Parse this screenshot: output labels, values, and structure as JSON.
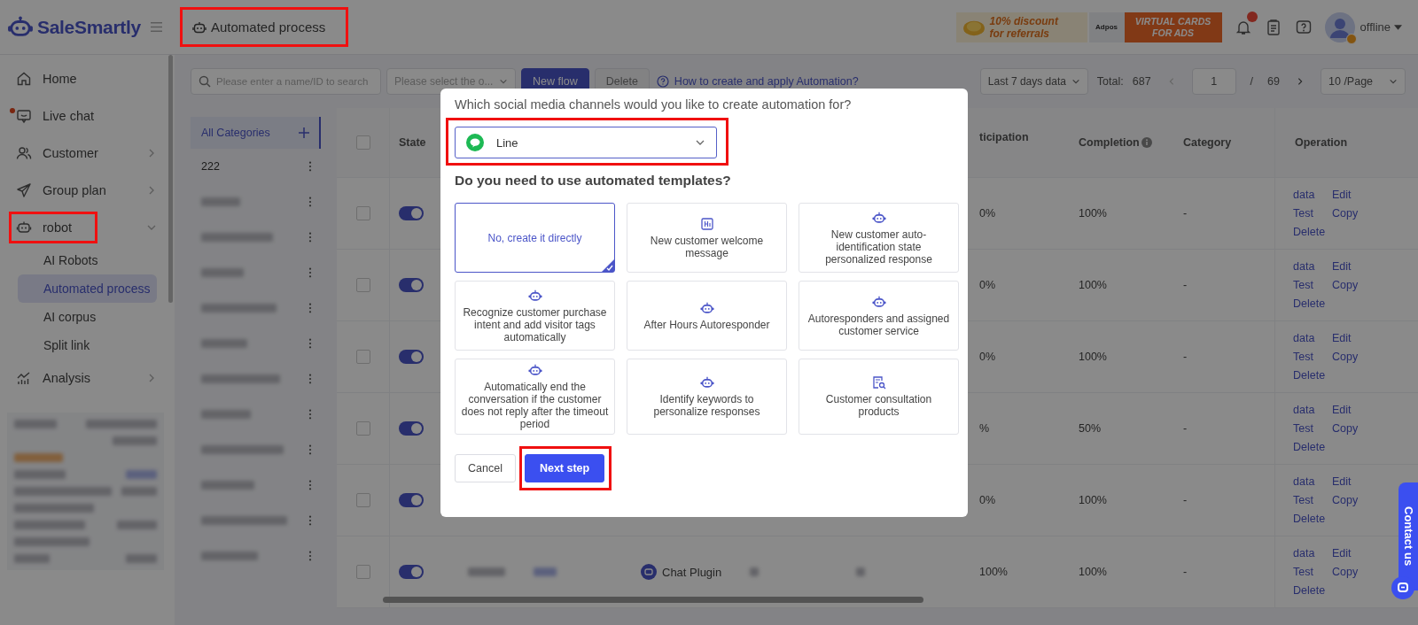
{
  "header": {
    "logo": "SaleSmartly",
    "title": "Automated process",
    "title_highlighted": true,
    "promos": [
      {
        "kind": "discount",
        "lines": [
          "10% discount",
          "for referrals"
        ]
      },
      {
        "kind": "cards",
        "brand": "Adpos",
        "lines": [
          "VIRTUAL CARDS",
          "FOR ADS"
        ]
      }
    ],
    "notification_badge": true,
    "user": {
      "status": "offline"
    }
  },
  "sidebar": {
    "items": [
      {
        "label": "Home",
        "kind": "link",
        "unread": false
      },
      {
        "label": "Live chat",
        "kind": "link",
        "unread": true
      },
      {
        "label": "Customer",
        "kind": "group",
        "unread": false,
        "expanded": false,
        "highlighted": false
      },
      {
        "label": "Group plan",
        "kind": "group",
        "unread": false,
        "expanded": false,
        "highlighted": false
      },
      {
        "label": "robot",
        "kind": "group",
        "unread": false,
        "expanded": true,
        "highlighted": true,
        "children": [
          {
            "label": "AI Robots",
            "selected": false
          },
          {
            "label": "Automated process",
            "selected": true
          },
          {
            "label": "AI corpus",
            "selected": false
          },
          {
            "label": "Split link",
            "selected": false
          }
        ]
      },
      {
        "label": "Analysis",
        "kind": "group",
        "unread": false,
        "expanded": false,
        "highlighted": false
      }
    ]
  },
  "toolbar": {
    "search": {
      "placeholder": "Please enter a name/ID to search"
    },
    "filter": {
      "placeholder": "Please select the o..."
    },
    "buttons": [
      {
        "label": "New flow",
        "kind": "primary",
        "disabled": false
      },
      {
        "label": "Delete",
        "kind": "default",
        "disabled": true
      }
    ],
    "help_link": "How to create and apply Automation?",
    "range": "Last 7 days data",
    "total_label": "Total:",
    "total": "687",
    "page": "1",
    "page_sep": "/",
    "pages": "69",
    "page_size": "10 /Page"
  },
  "categories": [
    {
      "kind": "all",
      "label": "All Categories",
      "selected": true
    },
    {
      "kind": "item",
      "label": "222",
      "selected": false,
      "redacted": false
    },
    {
      "kind": "item",
      "selected": false,
      "redacted": true
    },
    {
      "kind": "item",
      "selected": false,
      "redacted": true
    },
    {
      "kind": "item",
      "selected": false,
      "redacted": true
    },
    {
      "kind": "item",
      "selected": false,
      "redacted": true
    },
    {
      "kind": "item",
      "selected": false,
      "redacted": true
    },
    {
      "kind": "item",
      "selected": false,
      "redacted": true
    },
    {
      "kind": "item",
      "selected": false,
      "redacted": true
    },
    {
      "kind": "item",
      "selected": false,
      "redacted": true
    },
    {
      "kind": "item",
      "selected": false,
      "redacted": true
    },
    {
      "kind": "item",
      "selected": false,
      "redacted": true
    },
    {
      "kind": "item",
      "selected": false,
      "redacted": true
    }
  ],
  "table": {
    "all_checked": false,
    "columns": [
      {
        "label": "State",
        "info": false
      },
      {
        "label": "ticipation",
        "info": false
      },
      {
        "label": "Completion",
        "info": true
      },
      {
        "label": "Category",
        "info": false
      },
      {
        "label": "Operation",
        "info": false
      }
    ],
    "rows": [
      {
        "checked": false,
        "on": true,
        "participation": "0%",
        "completion": "100%",
        "category": "-",
        "actions": [
          "data",
          "Edit",
          "Test",
          "Copy",
          "Delete"
        ]
      },
      {
        "checked": false,
        "on": true,
        "participation": "0%",
        "completion": "100%",
        "category": "-",
        "actions": [
          "data",
          "Edit",
          "Test",
          "Copy",
          "Delete"
        ]
      },
      {
        "checked": false,
        "on": true,
        "participation": "0%",
        "completion": "100%",
        "category": "-",
        "actions": [
          "data",
          "Edit",
          "Test",
          "Copy",
          "Delete"
        ]
      },
      {
        "checked": false,
        "on": true,
        "participation": "%",
        "completion": "50%",
        "category": "-",
        "actions": [
          "data",
          "Edit",
          "Test",
          "Copy",
          "Delete"
        ]
      },
      {
        "checked": false,
        "on": true,
        "participation": "0%",
        "completion": "100%",
        "category": "-",
        "actions": [
          "data",
          "Edit",
          "Test",
          "Copy",
          "Delete"
        ]
      },
      {
        "checked": false,
        "on": true,
        "redacted_cells": true,
        "channel": "Chat Plugin",
        "participation": "100%",
        "completion": "100%",
        "category": "-",
        "actions": [
          "data",
          "Edit",
          "Test",
          "Copy",
          "Delete"
        ]
      }
    ]
  },
  "modal": {
    "question": "Which social media channels would you like to create automation for?",
    "channel": {
      "value": "Line",
      "highlighted": true
    },
    "templates_heading": "Do you need to use automated templates?",
    "templates": [
      {
        "kind": "plain",
        "label": "No, create it directly",
        "selected": true
      },
      {
        "kind": "greeting",
        "label": "New customer welcome message",
        "selected": false
      },
      {
        "kind": "robot",
        "label": "New customer auto-identification state personalized response",
        "selected": false
      },
      {
        "kind": "robot",
        "label": "Recognize customer purchase intent and add visitor tags automatically",
        "selected": false
      },
      {
        "kind": "robot",
        "label": "After Hours Autoresponder",
        "selected": false
      },
      {
        "kind": "robot",
        "label": "Autoresponders and assigned customer service",
        "selected": false
      },
      {
        "kind": "robot",
        "label": "Automatically end the conversation if the customer does not reply after the timeout period",
        "selected": false
      },
      {
        "kind": "robot",
        "label": "Identify keywords to personalize responses",
        "selected": false
      },
      {
        "kind": "lookup",
        "label": "Customer consultation products",
        "selected": false
      }
    ],
    "buttons": [
      {
        "label": "Cancel",
        "kind": "default",
        "highlighted": false
      },
      {
        "label": "Next step",
        "kind": "primary",
        "highlighted": true
      }
    ]
  },
  "contact": {
    "label": "Contact us"
  }
}
